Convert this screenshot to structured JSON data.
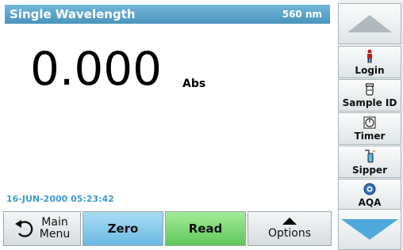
{
  "header": {
    "title": "Single Wavelength",
    "wavelength": "560 nm"
  },
  "measurement": {
    "value": "0.000",
    "unit": "Abs"
  },
  "status": {
    "datetime": "16-JUN-2000  05:23:42"
  },
  "bottom_bar": {
    "main_menu_line1": "Main",
    "main_menu_line2": "Menu",
    "zero": "Zero",
    "read": "Read",
    "options": "Options"
  },
  "side_bar": {
    "items": [
      {
        "label": "Login",
        "icon": "person-icon"
      },
      {
        "label": "Sample ID",
        "icon": "sample-container-icon"
      },
      {
        "label": "Timer",
        "icon": "timer-icon"
      },
      {
        "label": "Sipper",
        "icon": "sipper-icon"
      },
      {
        "label": "AQA",
        "icon": "aqa-icon"
      }
    ]
  },
  "colors": {
    "titlebar": "#5aa3ca",
    "zero_button": "#69b9e2",
    "read_button": "#5ec75a",
    "datetime_text": "#3f9ad0",
    "scroll_down_arrow": "#4fa8da"
  }
}
